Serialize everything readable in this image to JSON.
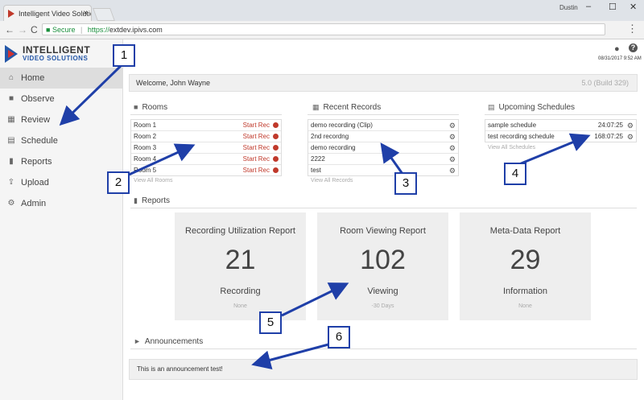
{
  "browser": {
    "tab_title": "Intelligent Video Solution",
    "tab_close": "×",
    "window_user": "Dustin",
    "window_controls": [
      "–",
      "☐",
      "✕"
    ],
    "nav_icons": [
      "←",
      "→",
      "C"
    ],
    "url_secure": "Secure",
    "url_scheme": "https://",
    "url_host": "extdev.ipivs.com",
    "menu": "⋮"
  },
  "logo": {
    "line1": "INTELLIGENT",
    "line2": "VIDEO SOLUTIONS"
  },
  "sidebar": {
    "items": [
      {
        "label": "Home",
        "icon": "home-icon",
        "glyph": "⌂"
      },
      {
        "label": "Observe",
        "icon": "video-camera-icon",
        "glyph": "■"
      },
      {
        "label": "Review",
        "icon": "film-icon",
        "glyph": "▦"
      },
      {
        "label": "Schedule",
        "icon": "calendar-icon",
        "glyph": "▤"
      },
      {
        "label": "Reports",
        "icon": "bar-chart-icon",
        "glyph": "▮"
      },
      {
        "label": "Upload",
        "icon": "upload-icon",
        "glyph": "⇪"
      },
      {
        "label": "Admin",
        "icon": "gear-icon",
        "glyph": "⚙"
      }
    ]
  },
  "header": {
    "datetime": "08/31/2017 9:52 AM",
    "user_glyph": "●",
    "help_glyph": "?"
  },
  "welcome": {
    "text": "Welcome, John Wayne",
    "build": "5.0 (Build 329)"
  },
  "rooms": {
    "title": "Rooms",
    "start_label": "Start Rec",
    "items": [
      "Room 1",
      "Room 2",
      "Room 3",
      "Room 4",
      "Room 5"
    ],
    "view_all": "View All Rooms"
  },
  "records": {
    "title": "Recent Records",
    "items": [
      "demo recording (Clip)",
      "2nd recordng",
      "demo recording",
      "2222",
      "test"
    ],
    "view_all": "View All Records"
  },
  "schedules": {
    "title": "Upcoming Schedules",
    "items": [
      {
        "name": "sample schedule",
        "time": "24:07:25"
      },
      {
        "name": "test recording schedule",
        "time": "168:07:25"
      }
    ],
    "view_all": "View All Schedules"
  },
  "reports": {
    "title": "Reports",
    "cards": [
      {
        "title": "Recording Utilization Report",
        "value": "21",
        "label": "Recording",
        "sub": "None"
      },
      {
        "title": "Room Viewing Report",
        "value": "102",
        "label": "Viewing",
        "sub": "-30 Days"
      },
      {
        "title": "Meta-Data Report",
        "value": "29",
        "label": "Information",
        "sub": "None"
      }
    ]
  },
  "announcements": {
    "title": "Announcements",
    "text": "This is an announcement test!"
  },
  "callouts": [
    "1",
    "2",
    "3",
    "4",
    "5",
    "6"
  ],
  "colors": {
    "callout_border": "#1f3fa8",
    "rec_red": "#c0392b",
    "brand_blue": "#2457a8"
  }
}
